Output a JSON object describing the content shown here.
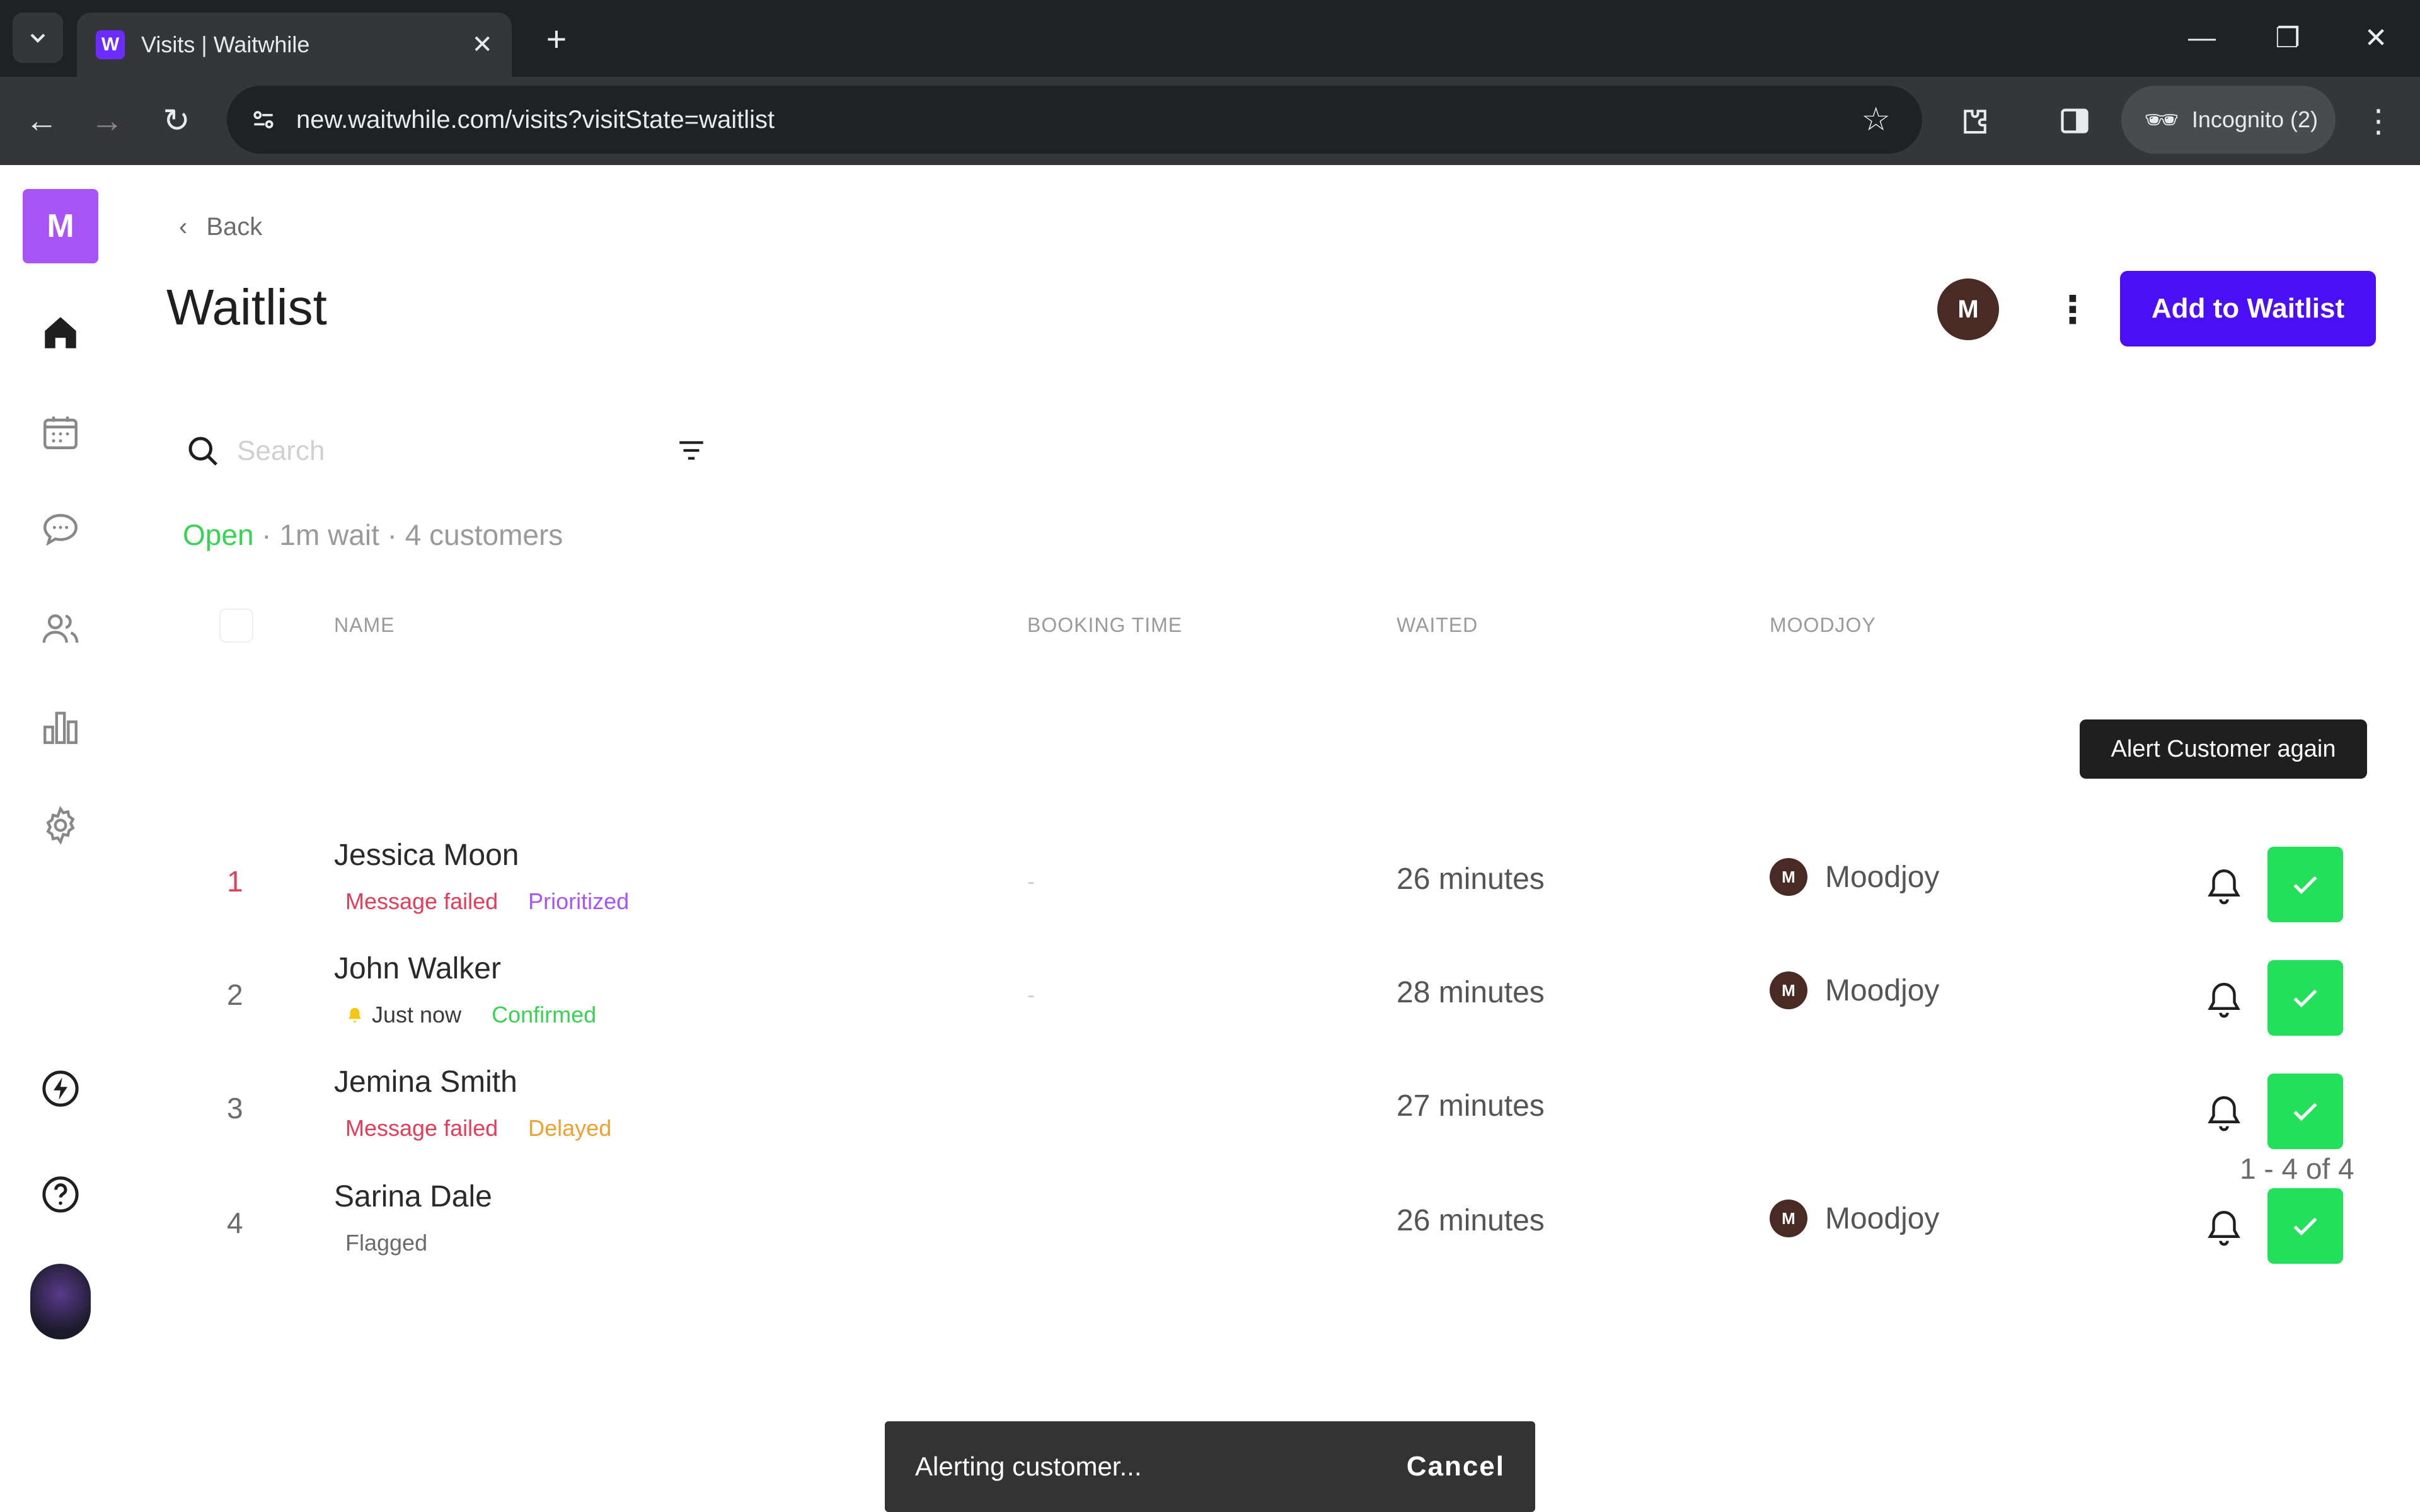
{
  "browser": {
    "tab_title": "Visits | Waitwhile",
    "favicon_letter": "W",
    "url": "new.waitwhile.com/visits?visitState=waitlist",
    "incognito_label": "Incognito (2)"
  },
  "sidebar": {
    "logo_letter": "M",
    "items": [
      {
        "icon": "home-icon"
      },
      {
        "icon": "calendar-icon"
      },
      {
        "icon": "chat-icon"
      },
      {
        "icon": "users-icon"
      },
      {
        "icon": "bar-chart-icon"
      },
      {
        "icon": "gear-icon"
      },
      {
        "icon": "lightning-icon"
      },
      {
        "icon": "help-icon"
      }
    ]
  },
  "header": {
    "back_label": "Back",
    "title": "Waitlist",
    "avatar_letter": "M",
    "add_button_label": "Add to Waitlist"
  },
  "search": {
    "placeholder": "Search"
  },
  "status": {
    "open": "Open",
    "rest": " · 1m wait · 4 customers"
  },
  "table": {
    "columns": [
      "NAME",
      "BOOKING TIME",
      "WAITED",
      "MOODJOY"
    ],
    "rows": [
      {
        "num": "1",
        "name": "Jessica Moon",
        "tags": [
          "Message failed",
          "Prioritized"
        ],
        "booking": "-",
        "waited": "26 minutes",
        "staff_letter": "M",
        "staff": "Moodjoy"
      },
      {
        "num": "2",
        "name": "John Walker",
        "tags": [
          "Just now",
          "Confirmed"
        ],
        "booking": "-",
        "waited": "28 minutes",
        "staff_letter": "M",
        "staff": "Moodjoy"
      },
      {
        "num": "3",
        "name": "Jemina Smith",
        "tags": [
          "Message failed",
          "Delayed"
        ],
        "booking": "",
        "waited": "27 minutes",
        "staff_letter": "",
        "staff": ""
      },
      {
        "num": "4",
        "name": "Sarina Dale",
        "tags": [
          "Flagged"
        ],
        "booking": "",
        "waited": "26 minutes",
        "staff_letter": "M",
        "staff": "Moodjoy"
      }
    ]
  },
  "tooltip": "Alert Customer again",
  "pagination": "1 - 4 of 4",
  "snackbar": {
    "text": "Alerting customer...",
    "action": "Cancel"
  },
  "colors": {
    "accent": "#4a0ff5",
    "logo": "#a855f7",
    "confirm_green": "#22e05a",
    "error_red": "#e23d5a"
  }
}
